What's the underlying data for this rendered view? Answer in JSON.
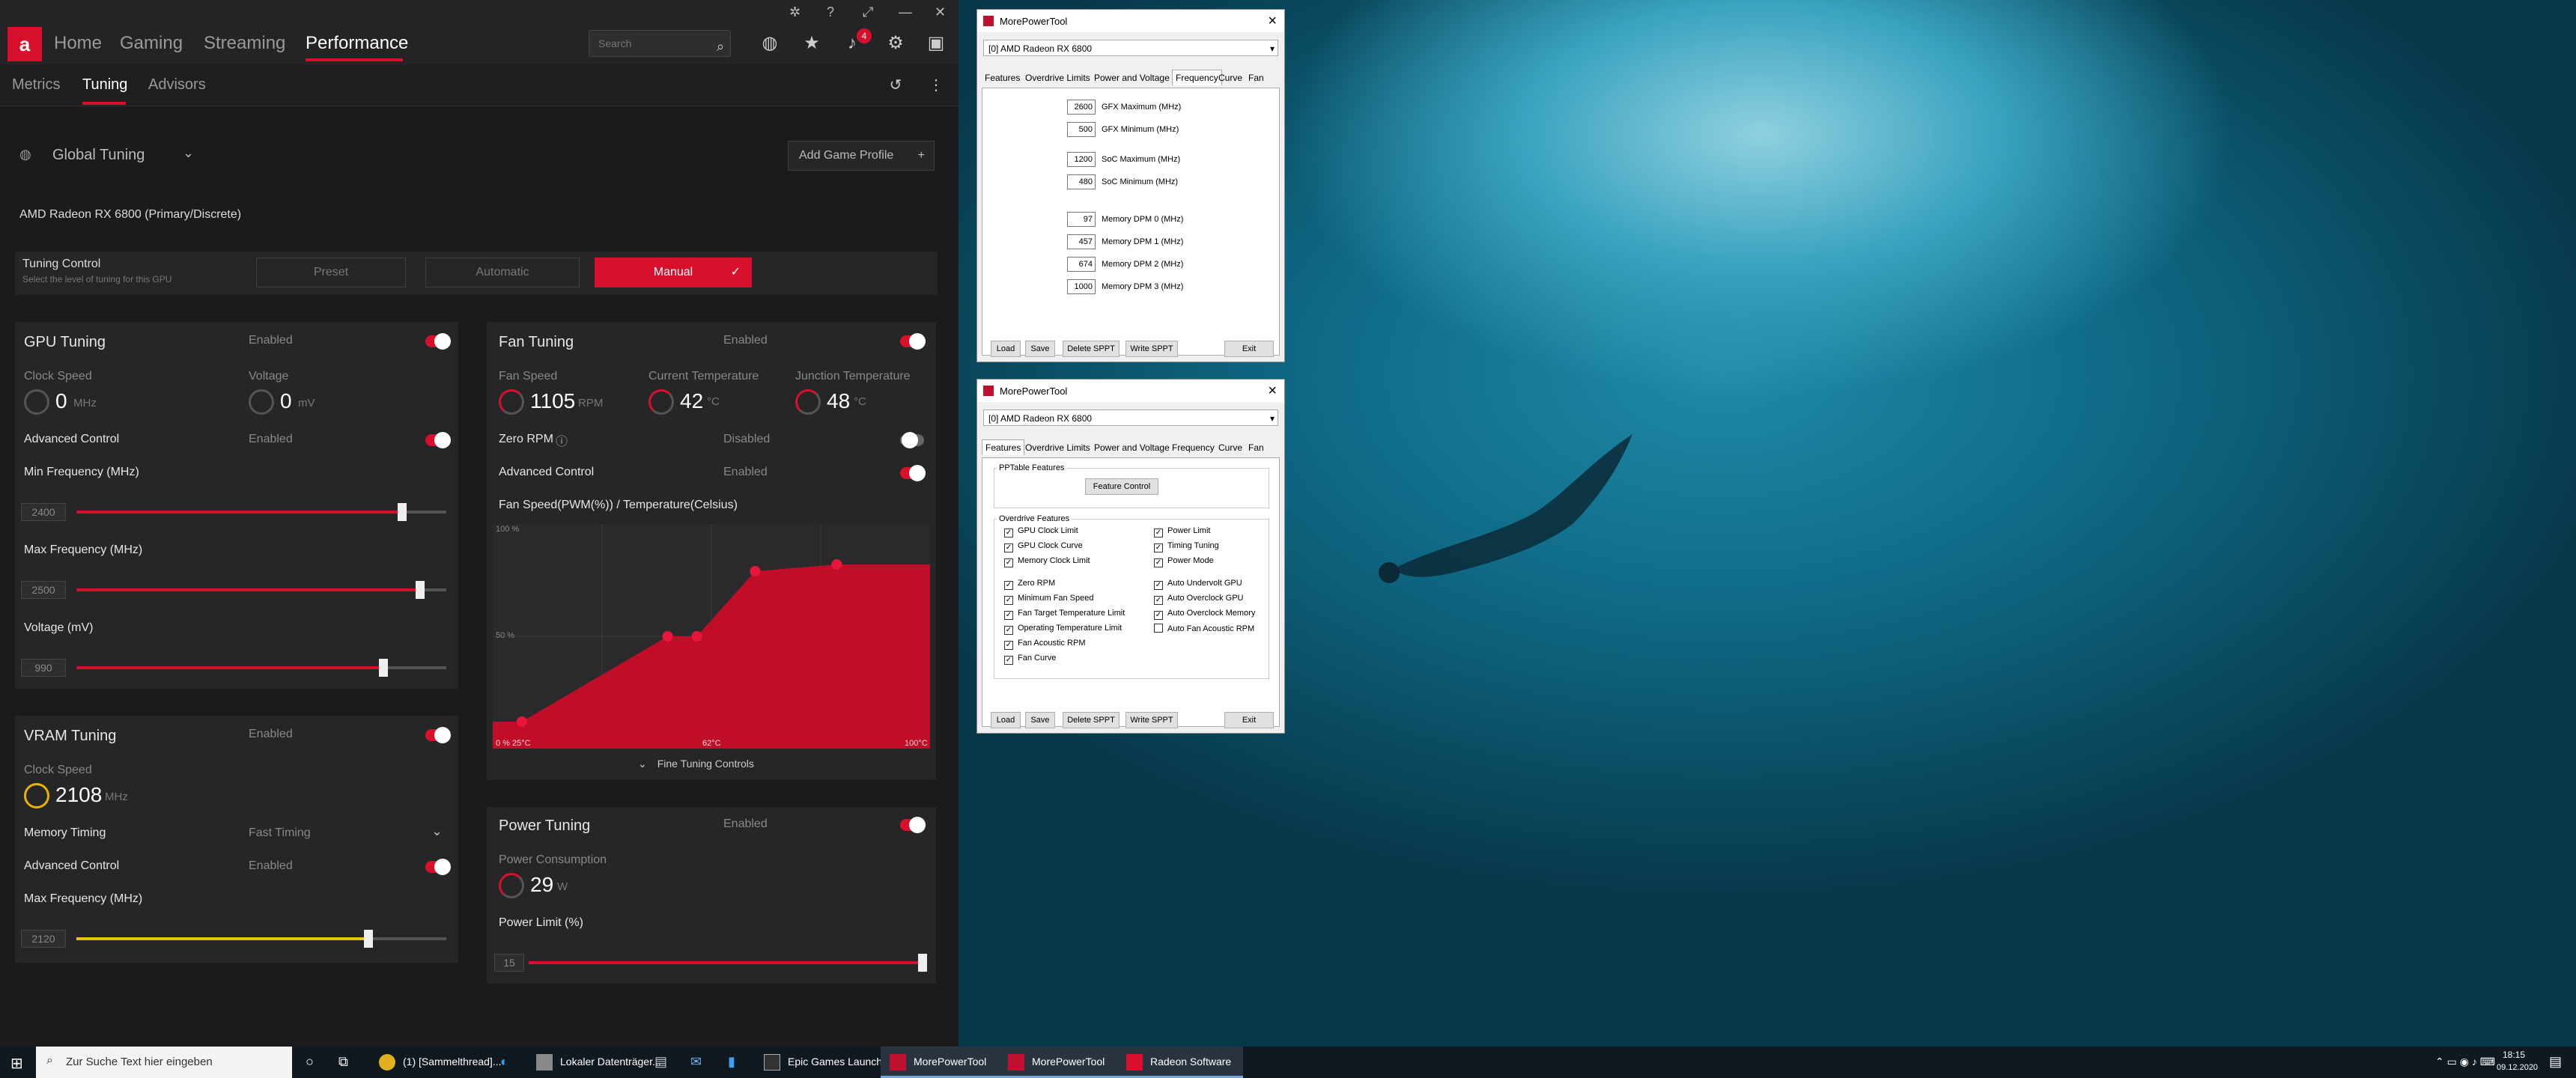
{
  "radeon": {
    "logo": "a",
    "nav": [
      "Home",
      "Gaming",
      "Streaming",
      "Performance"
    ],
    "search_placeholder": "Search",
    "notifications": "4",
    "subnav": [
      "Metrics",
      "Tuning",
      "Advisors"
    ],
    "profile": "Global Tuning",
    "add_profile": "Add Game Profile",
    "gpu_name": "AMD Radeon RX 6800 (Primary/Discrete)",
    "tuning_control": {
      "title": "Tuning Control",
      "desc": "Select the level of tuning for this GPU",
      "preset": "Preset",
      "automatic": "Automatic",
      "manual": "Manual"
    },
    "gpu": {
      "title": "GPU Tuning",
      "enabled": "Enabled",
      "clock_label": "Clock Speed",
      "clock_value": "0",
      "clock_unit": "MHz",
      "voltage_label": "Voltage",
      "voltage_value": "0",
      "voltage_unit": "mV",
      "adv": "Advanced Control",
      "adv_state": "Enabled",
      "min_label": "Min Frequency (MHz)",
      "min_value": "2400",
      "max_label": "Max Frequency (MHz)",
      "max_value": "2500",
      "volt_label": "Voltage (mV)",
      "volt_value": "990",
      "min_fraction": 0.88,
      "max_fraction": 0.93,
      "volt_fraction": 0.83
    },
    "vram": {
      "title": "VRAM Tuning",
      "enabled": "Enabled",
      "clock_label": "Clock Speed",
      "clock_value": "2108",
      "clock_unit": "MHz",
      "timing_label": "Memory Timing",
      "timing_value": "Fast Timing",
      "adv": "Advanced Control",
      "adv_state": "Enabled",
      "max_label": "Max Frequency (MHz)",
      "max_value": "2120",
      "max_fraction": 0.79
    },
    "fan": {
      "title": "Fan Tuning",
      "enabled": "Enabled",
      "speed_label": "Fan Speed",
      "speed_value": "1105",
      "speed_unit": "RPM",
      "cur_label": "Current Temperature",
      "cur_value": "42",
      "cur_unit": "°C",
      "junc_label": "Junction Temperature",
      "junc_value": "48",
      "junc_unit": "°C",
      "zero": "Zero RPM",
      "zero_state": "Disabled",
      "adv": "Advanced Control",
      "adv_state": "Enabled",
      "curve_title": "Fan Speed(PWM(%)) / Temperature(Celsius)",
      "y100": "100 %",
      "y50": "50 %",
      "x0": "0 %  25°C",
      "xmid": "62°C",
      "x100": "100°C",
      "fine": "Fine Tuning Controls"
    },
    "power": {
      "title": "Power Tuning",
      "enabled": "Enabled",
      "cons_label": "Power Consumption",
      "cons_value": "29",
      "cons_unit": "W",
      "limit_label": "Power Limit (%)",
      "limit_value": "15",
      "limit_fraction": 1.0
    }
  },
  "chart_data": {
    "type": "area",
    "title": "Fan Speed(PWM(%)) / Temperature(Celsius)",
    "xlabel": "",
    "ylabel": "",
    "xlim": [
      25,
      100
    ],
    "ylim": [
      0,
      100
    ],
    "x": [
      25,
      30,
      55,
      60,
      70,
      84,
      100
    ],
    "values": [
      12,
      12,
      50,
      50,
      79,
      82,
      82
    ],
    "points": [
      [
        30,
        12
      ],
      [
        55,
        50
      ],
      [
        60,
        50
      ],
      [
        70,
        79
      ],
      [
        84,
        82
      ]
    ]
  },
  "mpt1": {
    "title": "MorePowerTool",
    "device": "[0] AMD Radeon RX 6800",
    "tabs": [
      "Features",
      "Overdrive Limits",
      "Power and Voltage",
      "Frequency",
      "Curve",
      "Fan"
    ],
    "fields": [
      {
        "v": "2600",
        "l": "GFX Maximum (MHz)"
      },
      {
        "v": "500",
        "l": "GFX Minimum (MHz)"
      },
      {
        "v": "1200",
        "l": "SoC Maximum (MHz)"
      },
      {
        "v": "480",
        "l": "SoC Minimum (MHz)"
      },
      {
        "v": "97",
        "l": "Memory DPM 0 (MHz)"
      },
      {
        "v": "457",
        "l": "Memory DPM 1 (MHz)"
      },
      {
        "v": "674",
        "l": "Memory DPM 2 (MHz)"
      },
      {
        "v": "1000",
        "l": "Memory DPM 3 (MHz)"
      }
    ],
    "buttons": [
      "Load",
      "Save",
      "Delete SPPT",
      "Write SPPT",
      "Exit"
    ]
  },
  "mpt2": {
    "title": "MorePowerTool",
    "device": "[0] AMD Radeon RX 6800",
    "tabs": [
      "Features",
      "Overdrive Limits",
      "Power and Voltage",
      "Frequency",
      "Curve",
      "Fan"
    ],
    "pp_group": "PPTable Features",
    "feature_btn": "Feature Control",
    "od_group": "Overdrive Features",
    "left": [
      {
        "l": "GPU Clock Limit",
        "c": true
      },
      {
        "l": "GPU Clock Curve",
        "c": true
      },
      {
        "l": "Memory Clock Limit",
        "c": true
      },
      {
        "l": "Zero RPM",
        "c": true
      },
      {
        "l": "Minimum Fan Speed",
        "c": true
      },
      {
        "l": "Fan Target Temperature Limit",
        "c": true
      },
      {
        "l": "Operating Temperature Limit",
        "c": true
      },
      {
        "l": "Fan Acoustic RPM",
        "c": true
      },
      {
        "l": "Fan Curve",
        "c": true
      }
    ],
    "right": [
      {
        "l": "Power Limit",
        "c": true
      },
      {
        "l": "Timing Tuning",
        "c": true
      },
      {
        "l": "Power Mode",
        "c": true
      },
      {
        "l": "Auto Undervolt GPU",
        "c": true
      },
      {
        "l": "Auto Overclock GPU",
        "c": true
      },
      {
        "l": "Auto Overclock Memory",
        "c": true
      },
      {
        "l": "Auto Fan Acoustic RPM",
        "c": false
      }
    ],
    "buttons": [
      "Load",
      "Save",
      "Delete SPPT",
      "Write SPPT",
      "Exit"
    ]
  },
  "taskbar": {
    "search": "Zur Suche Text hier eingeben",
    "tasks": [
      "(1) [Sammelthread]...",
      "Lokaler Datenträger...",
      "Epic Games Launch...",
      "MorePowerTool",
      "MorePowerTool",
      "Radeon Software"
    ],
    "time": "18:15",
    "date": "09.12.2020"
  }
}
